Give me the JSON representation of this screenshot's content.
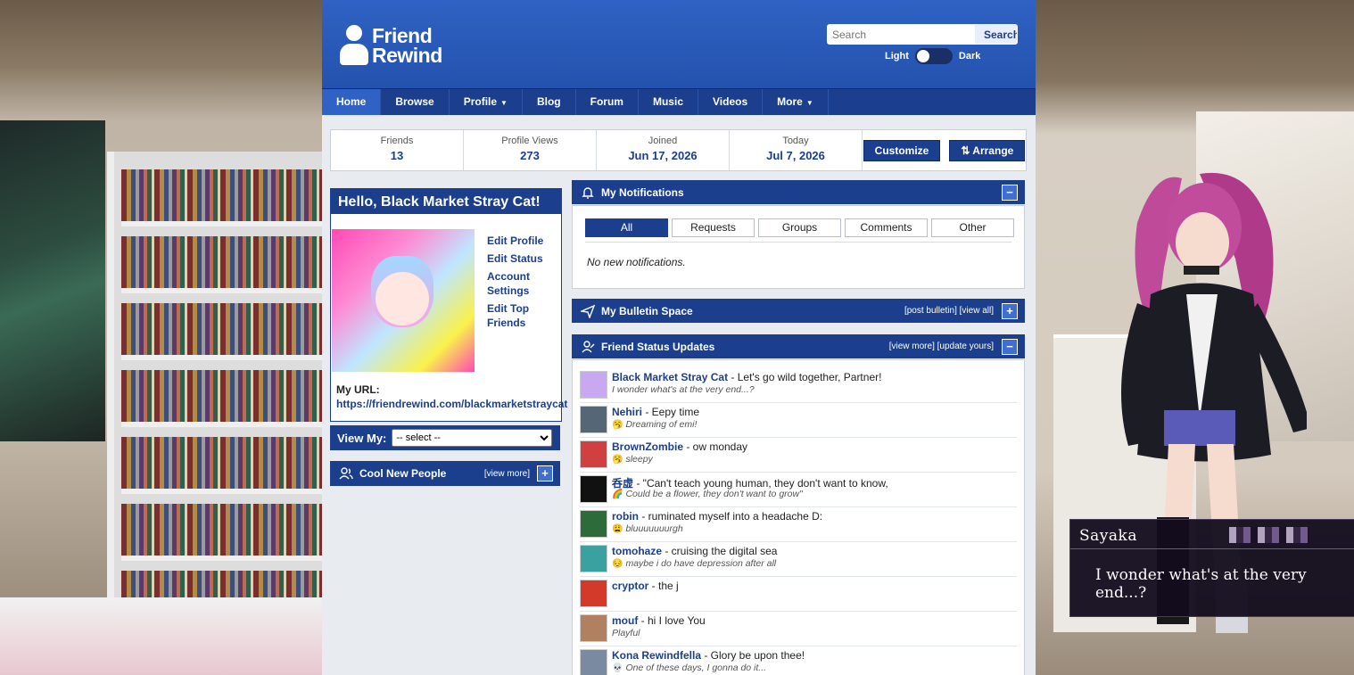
{
  "header": {
    "logo_line1": "Friend",
    "logo_line2": "Rewind",
    "search_placeholder": "Search",
    "search_button": "Search",
    "theme_light": "Light",
    "theme_dark": "Dark"
  },
  "nav": {
    "items": [
      "Home",
      "Browse",
      "Profile",
      "Blog",
      "Forum",
      "Music",
      "Videos",
      "More"
    ]
  },
  "stats": {
    "friends_label": "Friends",
    "friends_value": "13",
    "views_label": "Profile Views",
    "views_value": "273",
    "joined_label": "Joined",
    "joined_value": "Jun 17, 2026",
    "today_label": "Today",
    "today_value": "Jul 7, 2026",
    "customize": "Customize",
    "arrange": "⇅ Arrange"
  },
  "hello": {
    "title": "Hello, Black Market Stray Cat!",
    "edit_profile": "Edit Profile",
    "edit_status": "Edit Status",
    "account_settings": "Account Settings",
    "edit_top_friends": "Edit Top Friends",
    "url_label": "My URL:",
    "url": "https://friendrewind.com/blackmarketstraycat"
  },
  "view_my": {
    "label": "View My:",
    "selected": "-- select --"
  },
  "cool_people": {
    "title": "Cool New People",
    "view_more": "[view more]"
  },
  "notifications": {
    "title": "My Notifications",
    "tabs": [
      "All",
      "Requests",
      "Groups",
      "Comments",
      "Other"
    ],
    "empty": "No new notifications."
  },
  "bulletin": {
    "title": "My Bulletin Space",
    "links": "[post bulletin]  [view all]"
  },
  "status_updates": {
    "title": "Friend Status Updates",
    "links": "[view more]  [update yours]",
    "rows": [
      {
        "name": "Black Market Stray Cat",
        "text": " - Let's go wild together, Partner!",
        "mood": "",
        "sub": "I wonder what's at the very end...?",
        "color": "#c8a8f0"
      },
      {
        "name": "Nehiri",
        "text": " - Eepy time",
        "mood": "🥱",
        "sub": "Dreaming of emi!",
        "color": "#556677"
      },
      {
        "name": "BrownZombie",
        "text": " - ow monday",
        "mood": "🥱",
        "sub": "sleepy",
        "color": "#d04040"
      },
      {
        "name": "呑虚",
        "text": " - \"Can't teach young human, they don't want to know,",
        "mood": "🌈",
        "sub": "Could be a flower, they don't want to grow\"",
        "color": "#111111"
      },
      {
        "name": "robin",
        "text": " - ruminated myself into a headache D:",
        "mood": "😩",
        "sub": "bluuuuuuurgh",
        "color": "#2e6b3a"
      },
      {
        "name": "tomohaze",
        "text": " - cruising the digital sea",
        "mood": "😔",
        "sub": "maybe i do have depression after all",
        "color": "#3aa0a0"
      },
      {
        "name": "cryptor",
        "text": " - the j",
        "mood": "",
        "sub": "",
        "color": "#d43a2a"
      },
      {
        "name": "mouf",
        "text": " - hi I love You",
        "mood": "",
        "sub": "Playful",
        "color": "#b08060"
      },
      {
        "name": "Kona Rewindfella",
        "text": " - Glory be upon thee!",
        "mood": "💀",
        "sub": "One of these days, I gonna do it...",
        "color": "#7a8aa0"
      }
    ]
  },
  "dialogue": {
    "speaker": "Sayaka",
    "line": "I wonder what's at the very end...?"
  },
  "colors": {
    "brand": "#1b3f8c",
    "header": "#2f62c4"
  }
}
